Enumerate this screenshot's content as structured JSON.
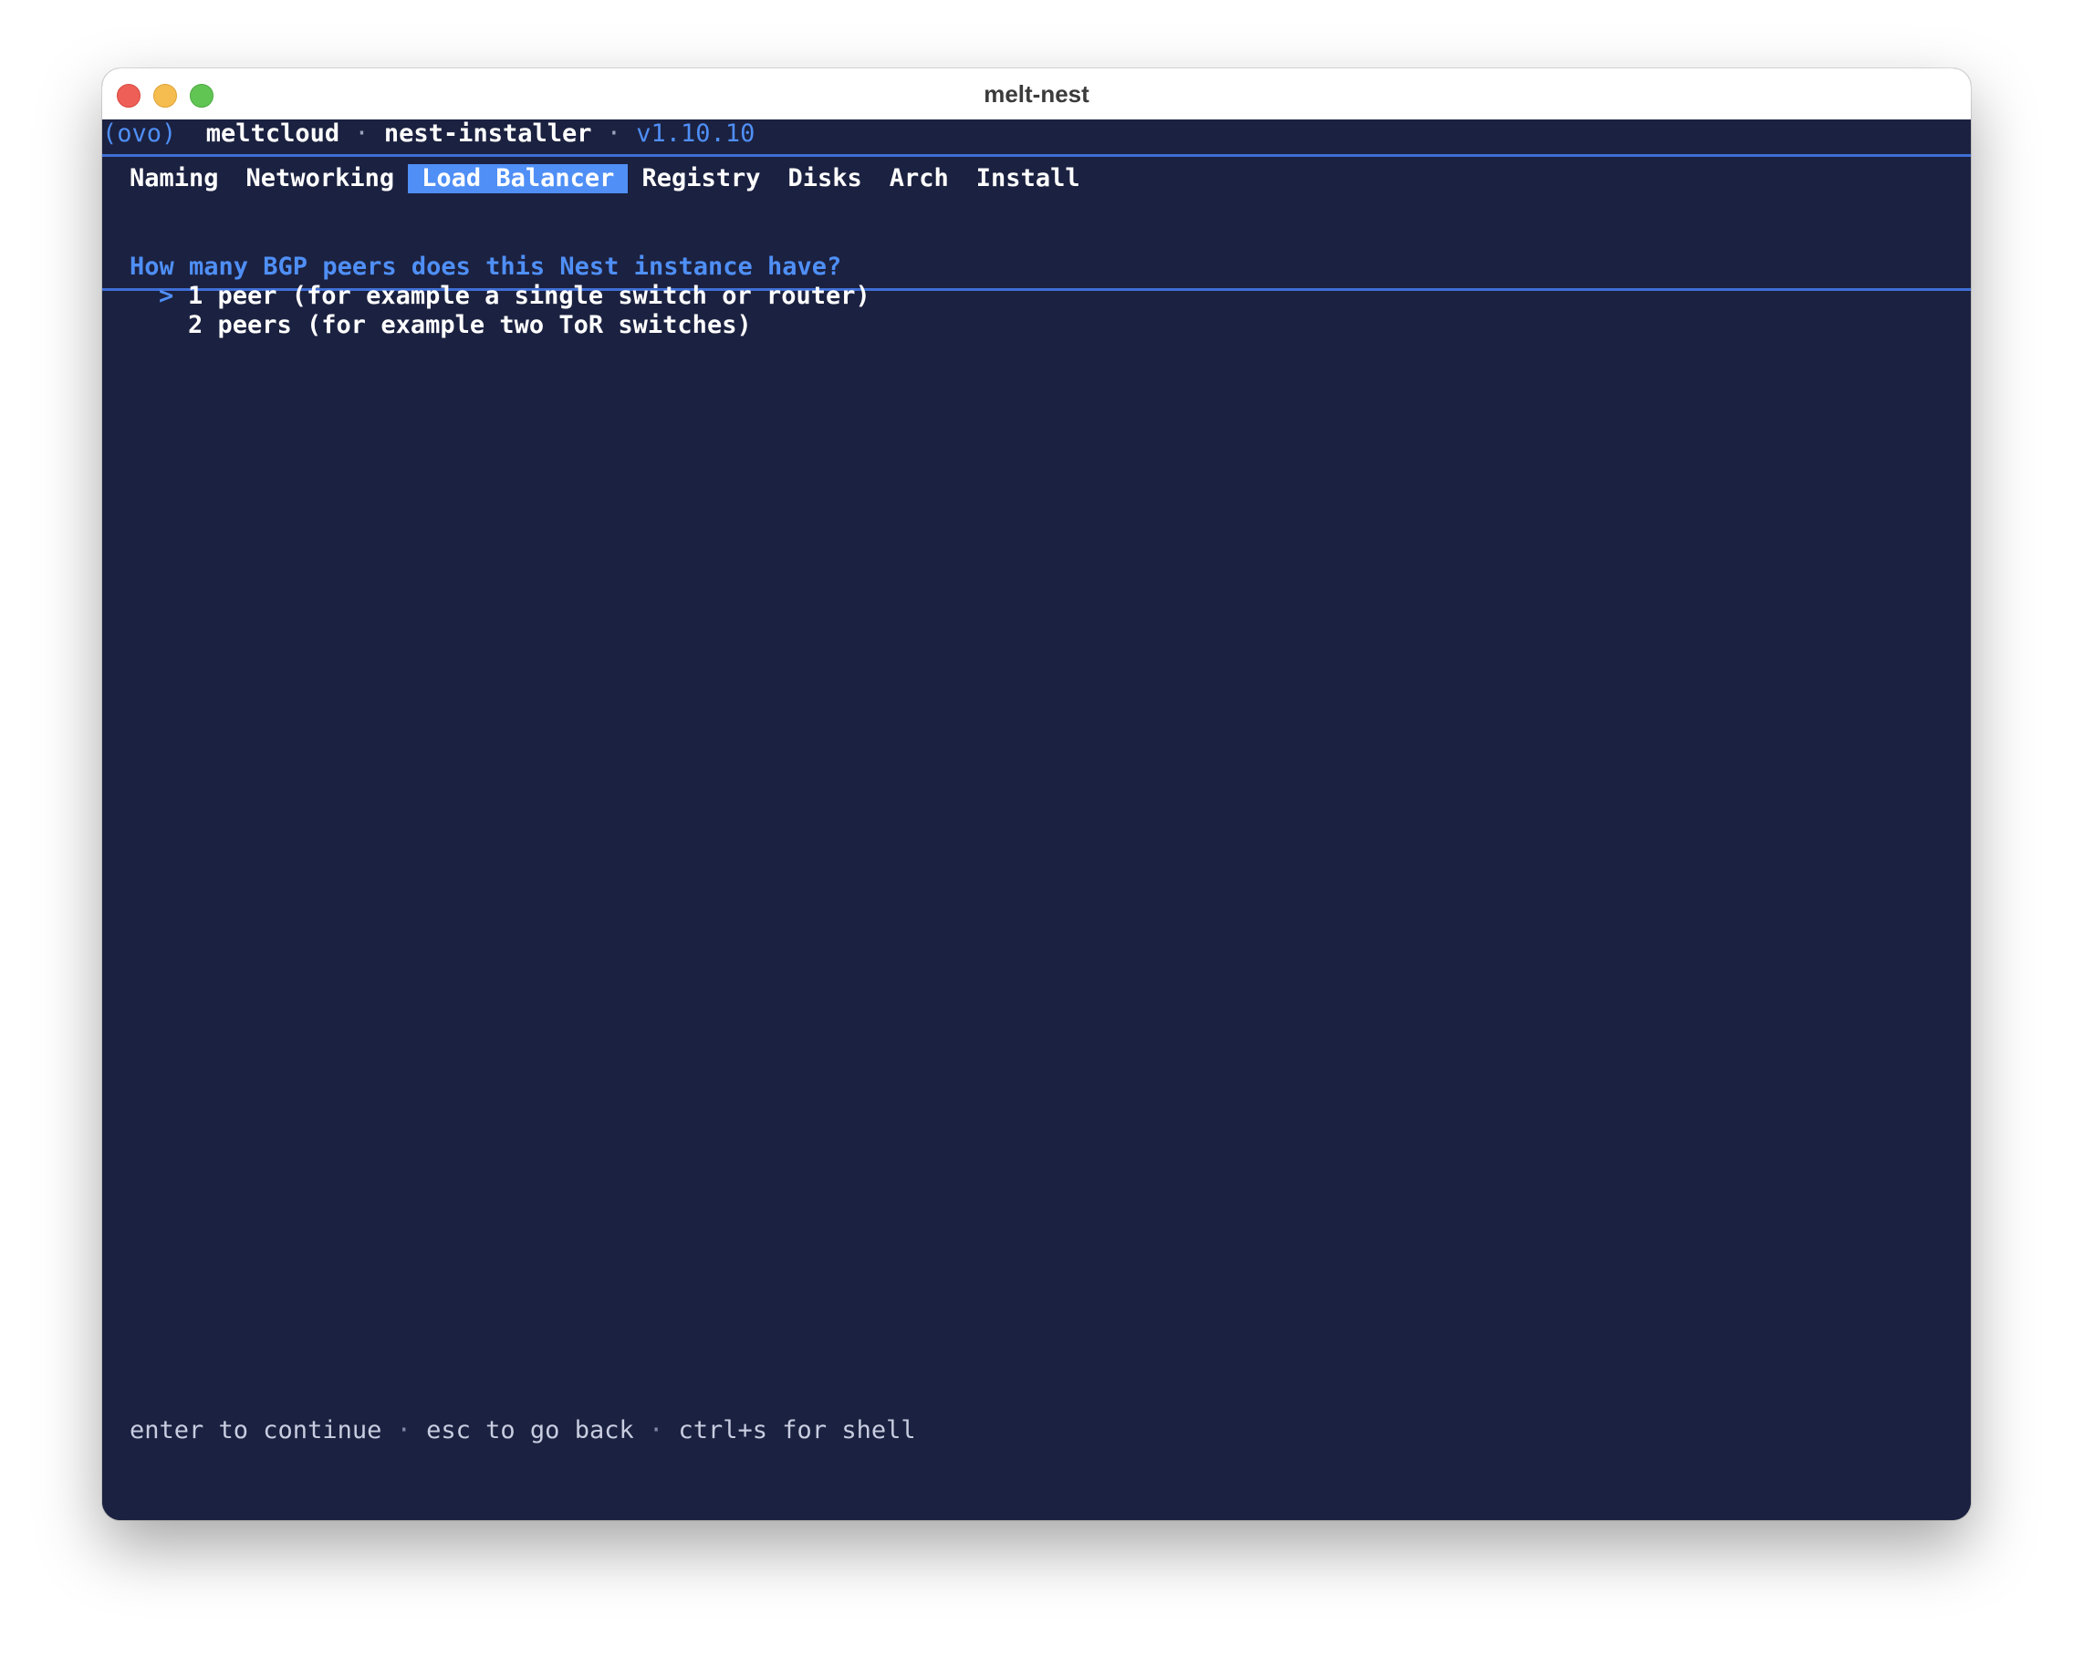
{
  "window": {
    "title": "melt-nest"
  },
  "header": {
    "logo": "(ovo)",
    "product": "meltcloud",
    "separator": "·",
    "app": "nest-installer",
    "version": "v1.10.10"
  },
  "tabs": [
    {
      "label": "Naming",
      "active": false
    },
    {
      "label": "Networking",
      "active": false
    },
    {
      "label": "Load Balancer",
      "active": true
    },
    {
      "label": "Registry",
      "active": false
    },
    {
      "label": "Disks",
      "active": false
    },
    {
      "label": "Arch",
      "active": false
    },
    {
      "label": "Install",
      "active": false
    }
  ],
  "prompt": {
    "question": "How many BGP peers does this Nest instance have?",
    "cursor": ">",
    "options": [
      {
        "label": "1 peer (for example a single switch or router)",
        "selected": true
      },
      {
        "label": "2 peers (for example two ToR switches)",
        "selected": false
      }
    ]
  },
  "footer": {
    "hints": [
      "enter to continue",
      "esc to go back",
      "ctrl+s for shell"
    ],
    "separator": "·"
  },
  "colors": {
    "background": "#1b2140",
    "accent": "#4f8ff6",
    "text": "#ffffff"
  }
}
